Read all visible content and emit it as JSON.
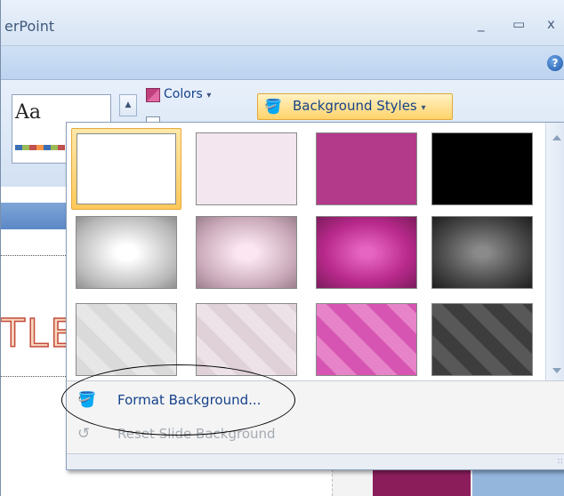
{
  "window": {
    "title": "erPoint",
    "minimize_glyph": "_",
    "restore_glyph": "▭",
    "close_glyph": "x",
    "help_glyph": "?"
  },
  "ribbon": {
    "theme_preview_text": "Aa",
    "colors_label": "Colors",
    "colors_arrow": "▾",
    "background_styles_label": "Background Styles",
    "background_styles_arrow": "▾",
    "scroll_up_glyph": "▲"
  },
  "slide": {
    "title_fragment": "TLE"
  },
  "gallery": {
    "selected_index": 0,
    "swatches": [
      {
        "name": "style-1",
        "fill": "#ffffff"
      },
      {
        "name": "style-2",
        "fill": "#f3e6ee"
      },
      {
        "name": "style-3",
        "fill": "#b33a8b"
      },
      {
        "name": "style-4",
        "fill": "#000000"
      },
      {
        "name": "style-5",
        "fill": "radial-gradient(ellipse at center, #ffffff 15%, #b8b8b8 75%, #8f8f8f 100%)"
      },
      {
        "name": "style-6",
        "fill": "radial-gradient(ellipse at center, #fbe6f1 15%, #c8a8b8 70%, #9c7f8c 100%)"
      },
      {
        "name": "style-7",
        "fill": "radial-gradient(ellipse at center, #e664c2 10%, #b8298b 60%, #7c1c5d 100%)"
      },
      {
        "name": "style-8",
        "fill": "radial-gradient(ellipse at center, #8a8a8a 10%, #4a4a4a 60%, #1e1e1e 100%)"
      },
      {
        "name": "style-9",
        "fill": "repeating-linear-gradient(45deg,#dadada 0 16px,#e7e7e7 16px 32px)"
      },
      {
        "name": "style-10",
        "fill": "repeating-linear-gradient(45deg,#dfd1d7 0 16px,#ece2e7 16px 32px)"
      },
      {
        "name": "style-11",
        "fill": "repeating-linear-gradient(45deg,#d655b2 0 16px,#e783c8 16px 32px)"
      },
      {
        "name": "style-12",
        "fill": "repeating-linear-gradient(45deg,#3d3d3d 0 16px,#585858 16px 32px)"
      }
    ]
  },
  "menu": {
    "format_background_label": "Format Background...",
    "reset_background_label": "Reset Slide Background",
    "grip_glyph": "::"
  },
  "icons": {
    "paint_bucket": "🪣",
    "reset": "↺"
  }
}
